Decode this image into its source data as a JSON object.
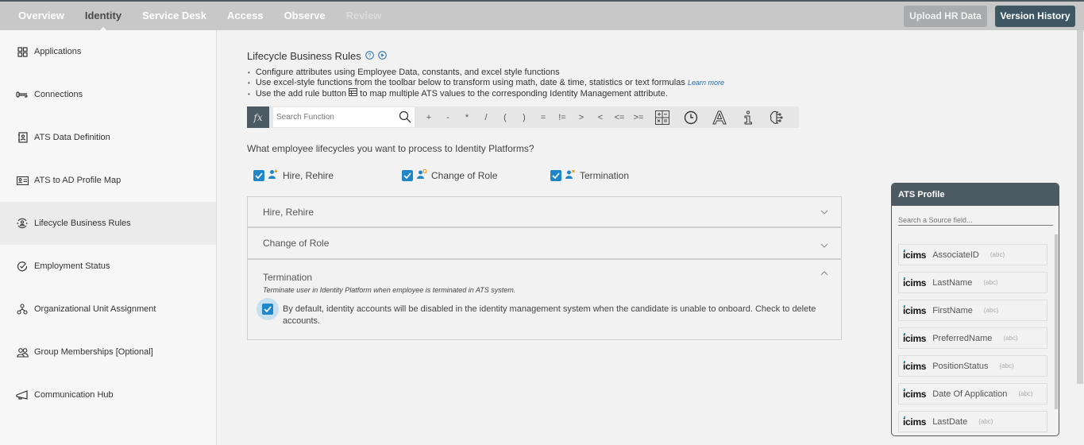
{
  "topbar": {
    "nav": [
      {
        "label": "Overview",
        "state": "normal"
      },
      {
        "label": "Identity",
        "state": "active"
      },
      {
        "label": "Service Desk",
        "state": "normal"
      },
      {
        "label": "Access",
        "state": "normal"
      },
      {
        "label": "Observe",
        "state": "normal"
      },
      {
        "label": "Review",
        "state": "disabled"
      }
    ],
    "upload_label": "Upload HR Data",
    "version_label": "Version History"
  },
  "sidebar": {
    "items": [
      {
        "label": "Applications",
        "icon": "grid-icon"
      },
      {
        "label": "Connections",
        "icon": "connection-icon"
      },
      {
        "label": "ATS Data Definition",
        "icon": "contact-book-icon"
      },
      {
        "label": "ATS to AD Profile Map",
        "icon": "id-card-icon"
      },
      {
        "label": "Lifecycle Business Rules",
        "icon": "user-cycle-icon",
        "active": true
      },
      {
        "label": "Employment Status",
        "icon": "check-circle-icon"
      },
      {
        "label": "Organizational Unit Assignment",
        "icon": "hierarchy-icon"
      },
      {
        "label": "Group Memberships [Optional]",
        "icon": "group-icon"
      },
      {
        "label": "Communication Hub",
        "icon": "megaphone-icon"
      }
    ]
  },
  "main": {
    "title": "Lifecycle Business Rules",
    "bullets": [
      "Configure attributes using Employee Data, constants, and excel style functions",
      "Use excel-style functions from the toolbar below to transform using math, date & time, statistics or text formulas",
      "Use the add rule button",
      "to map multiple ATS values to the corresponding Identity Management attribute."
    ],
    "learn_more": "Learn more",
    "toolbar": {
      "fx": "fx",
      "search_placeholder": "Search Function",
      "operators": [
        "+",
        "-",
        "*",
        "/",
        "(",
        ")",
        "=",
        "!=",
        ">",
        "<",
        "<=",
        ">="
      ]
    },
    "question": "What employee lifecycles you want to process to Identity Platforms?",
    "lifecycles": [
      {
        "label": "Hire, Rehire",
        "checked": true
      },
      {
        "label": "Change of Role",
        "checked": true
      },
      {
        "label": "Termination",
        "checked": true
      }
    ],
    "panels": {
      "hire": "Hire, Rehire",
      "change": "Change of Role",
      "termination": {
        "title": "Termination",
        "subtitle": "Terminate user in Identity Platform when employee is terminated in ATS system.",
        "option": "By default, identity accounts will be disabled in the identity management system when the candidate is unable to onboard. Check to delete accounts.",
        "option_checked": true
      }
    }
  },
  "ats_profile": {
    "title": "ATS Profile",
    "search_placeholder": "Search a Source field...",
    "logo_text": "icims",
    "type_label": "(abc)",
    "fields": [
      "AssociateID",
      "LastName",
      "FirstName",
      "PreferredName",
      "PositionStatus",
      "Date Of Application",
      "LastDate"
    ]
  }
}
